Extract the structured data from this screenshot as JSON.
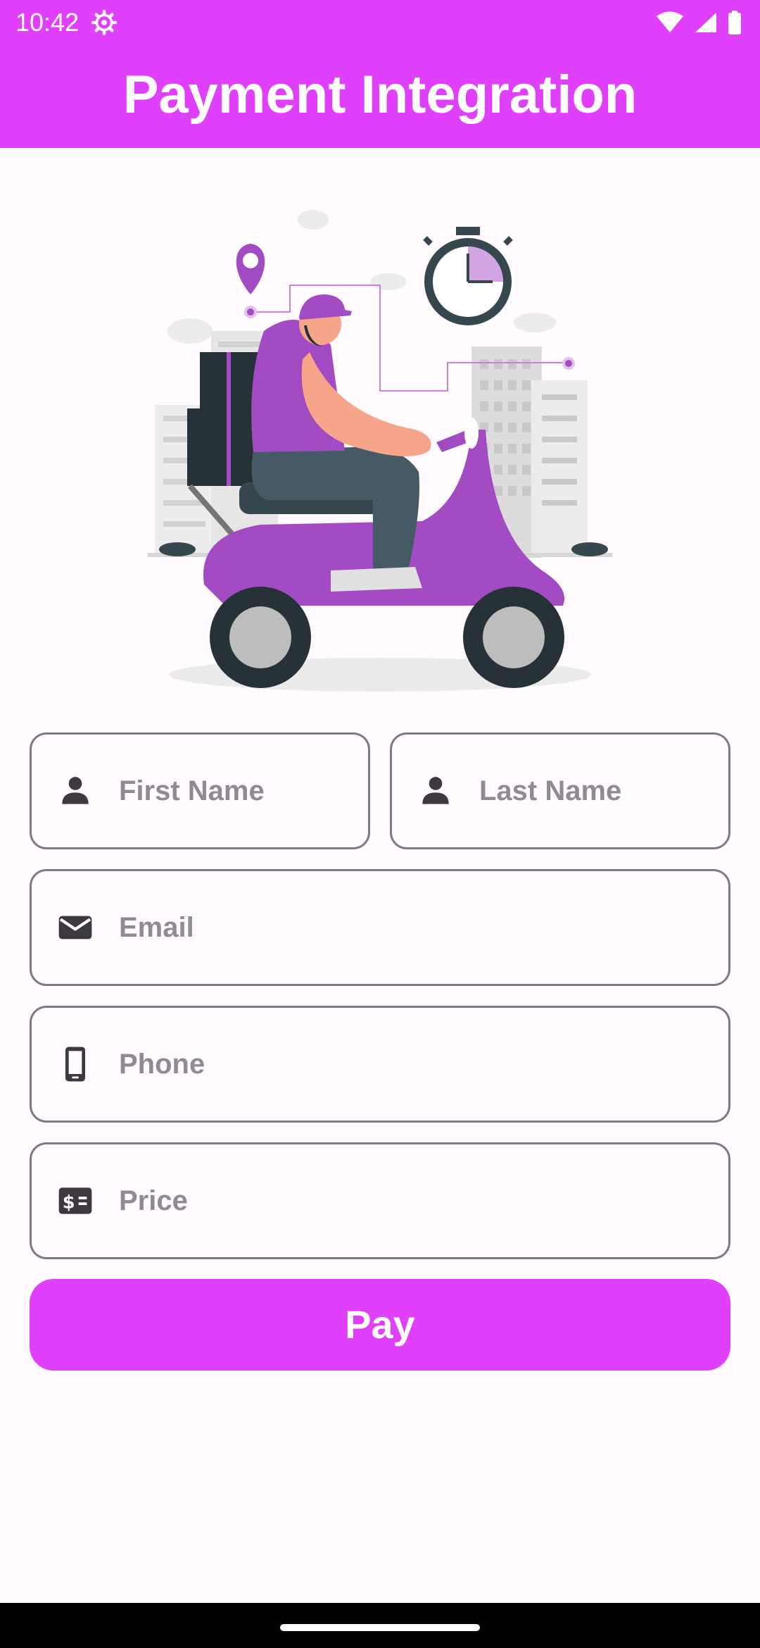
{
  "status_bar": {
    "time": "10:42",
    "icons": [
      "settings-gear-icon",
      "wifi-icon",
      "signal-icon",
      "battery-icon"
    ]
  },
  "app_bar": {
    "title": "Payment Integration",
    "color": "#e040fb"
  },
  "illustration": {
    "icon": "delivery-scooter-illustration",
    "accent_color": "#a24bc2"
  },
  "form": {
    "first_name": {
      "placeholder": "First Name",
      "icon": "person-icon"
    },
    "last_name": {
      "placeholder": "Last Name",
      "icon": "person-icon"
    },
    "email": {
      "placeholder": "Email",
      "icon": "mail-icon"
    },
    "phone": {
      "placeholder": "Phone",
      "icon": "phone-icon"
    },
    "price": {
      "placeholder": "Price",
      "icon": "price-icon"
    }
  },
  "pay_button": {
    "label": "Pay",
    "color": "#e040fb"
  }
}
